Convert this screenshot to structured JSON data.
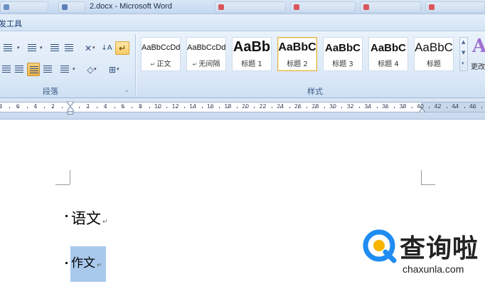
{
  "window": {
    "title": "2.docx - Microsoft Word"
  },
  "context_tab": {
    "label": "发工具"
  },
  "ribbon": {
    "paragraph_group_label": "段落",
    "styles_group_label": "样式",
    "change_styles_label": "更改",
    "change_styles_glyph": "A",
    "styles": [
      {
        "sample": "AaBbCcDd",
        "name": "正文",
        "marker": "↵"
      },
      {
        "sample": "AaBbCcDd",
        "name": "无间隔",
        "marker": "↵"
      },
      {
        "sample": "AaBb",
        "name": "标题 1"
      },
      {
        "sample": "AaBbC",
        "name": "标题 2",
        "selected": true
      },
      {
        "sample": "AaBbC",
        "name": "标题 3"
      },
      {
        "sample": "AaBbC",
        "name": "标题 4"
      },
      {
        "sample": "AaBbC",
        "name": "标题"
      }
    ]
  },
  "ruler": {
    "left_labels": [
      "8",
      "6",
      "4",
      "2"
    ],
    "right_labels": [
      "2",
      "4",
      "6",
      "8",
      "10",
      "12",
      "14",
      "16",
      "18",
      "20",
      "22",
      "24",
      "26",
      "28",
      "30",
      "32",
      "34",
      "36",
      "38",
      "40",
      "42",
      "44",
      "46"
    ]
  },
  "document": {
    "paragraphs": [
      {
        "text": "语文",
        "mark": "↵"
      },
      {
        "text": "作文",
        "mark": "↵",
        "selected": true
      }
    ]
  },
  "watermark": {
    "brand": "查询啦",
    "url": "chaxunla.com"
  },
  "colors": {
    "ribbon": "#dbe8f7",
    "selection": "#a9c9ec",
    "accent": "#f1b546",
    "watermark_blue": "#1e8cf0"
  }
}
